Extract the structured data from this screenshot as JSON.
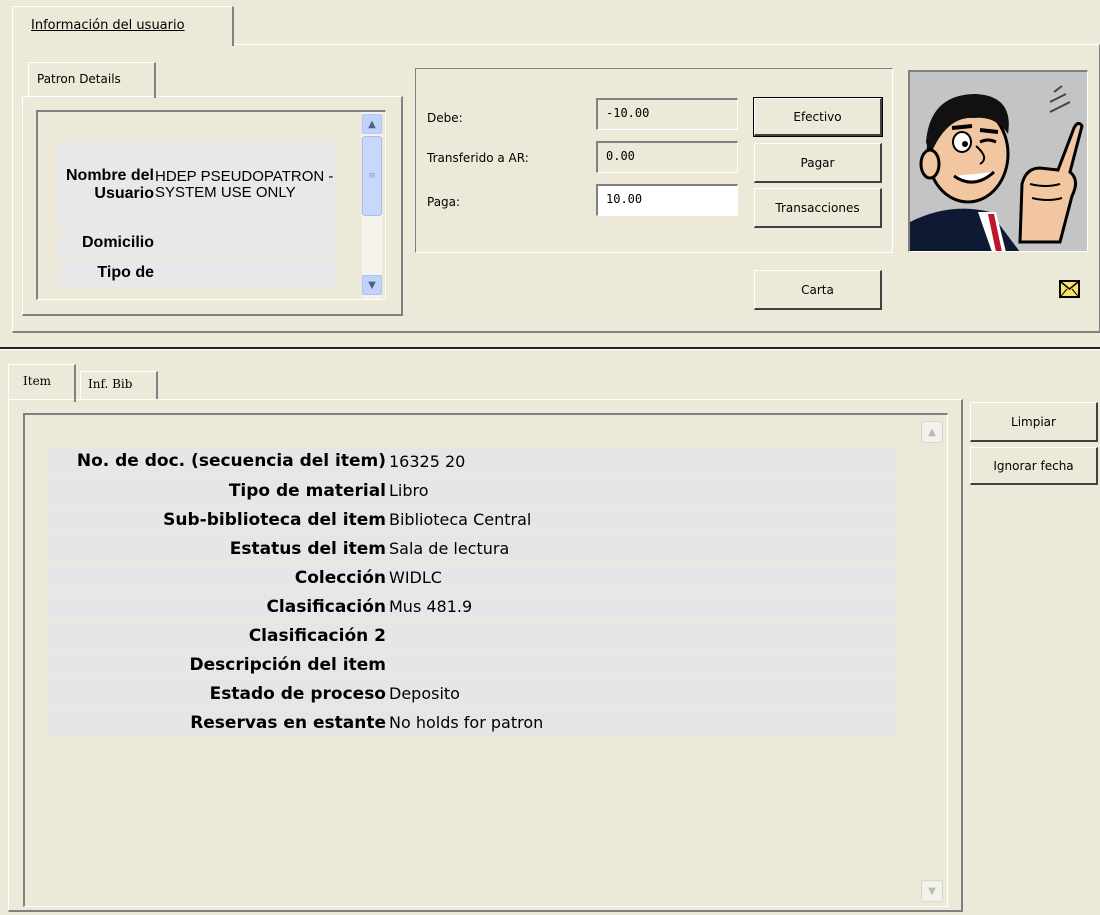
{
  "top_tab": {
    "label": "Información del usuario"
  },
  "patron_details": {
    "tab_label": "Patron Details",
    "rows": [
      {
        "label": "Nombre del Usuario",
        "value": "HDEP PSEUDOPATRON - SYSTEM USE ONLY"
      },
      {
        "label": "Domicilio",
        "value": ""
      },
      {
        "label": "Tipo de",
        "value": ""
      }
    ]
  },
  "payment": {
    "debe_label": "Debe:",
    "debe_value": "-10.00",
    "transferido_label": "Transferido a AR:",
    "transferido_value": "0.00",
    "paga_label": "Paga:",
    "paga_value": "10.00",
    "efectivo_button": "Efectivo",
    "pagar_button": "Pagar",
    "transacciones_button": "Transacciones",
    "carta_button": "Carta"
  },
  "bottom_tabs": {
    "item_tab": "Item",
    "bib_tab": "Inf. Bib"
  },
  "side_buttons": {
    "limpiar": "Limpiar",
    "ignorar_fecha": "Ignorar fecha"
  },
  "item_details": [
    {
      "label": "No. de doc. (secuencia del item)",
      "value": "16325 20"
    },
    {
      "label": "Tipo de material",
      "value": "Libro"
    },
    {
      "label": "Sub-biblioteca del item",
      "value": "Biblioteca Central"
    },
    {
      "label": "Estatus del item",
      "value": "Sala de lectura"
    },
    {
      "label": "Colección",
      "value": "WIDLC"
    },
    {
      "label": "Clasificación",
      "value": "Mus 481.9"
    },
    {
      "label": "Clasificación 2",
      "value": ""
    },
    {
      "label": "Descripción del item",
      "value": ""
    },
    {
      "label": "Estado de proceso",
      "value": "Deposito"
    },
    {
      "label": "Reservas en estante",
      "value": "No holds for patron"
    }
  ],
  "icons": {
    "patron_picture": "cartoon-man-pointing-icon",
    "mail": "envelope-icon",
    "scroll_up": "chevron-up-icon",
    "scroll_down": "chevron-down-icon"
  },
  "colors": {
    "window_bg": "#ece9d8",
    "scroll_blue": "#c1d3fb",
    "envelope": "#f5e26a"
  }
}
